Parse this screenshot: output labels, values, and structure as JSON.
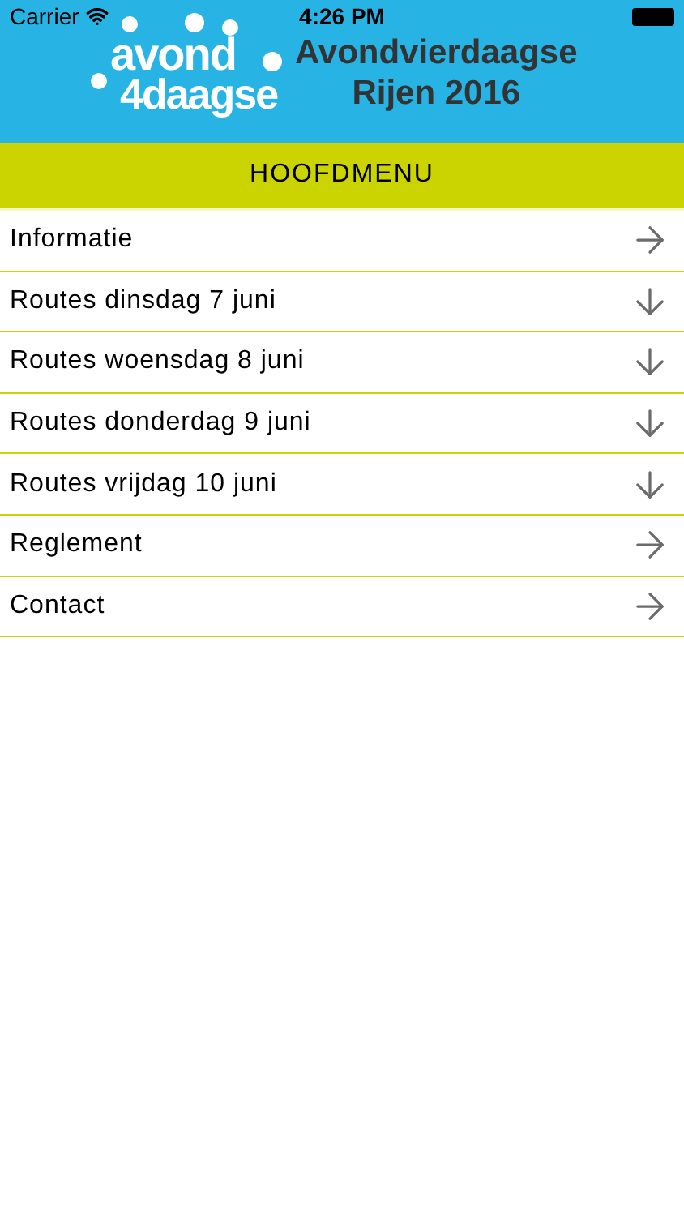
{
  "status_bar": {
    "carrier": "Carrier",
    "time": "4:26 PM"
  },
  "header": {
    "logo": [
      "avond",
      "4daagse"
    ],
    "title": [
      "Avondvierdaagse",
      "Rijen 2016"
    ]
  },
  "menu_title": "HOOFDMENU",
  "items": [
    {
      "label": "Informatie",
      "kind": "link"
    },
    {
      "label": "Routes dinsdag 7 juni",
      "kind": "expand"
    },
    {
      "label": "Routes woensdag 8 juni",
      "kind": "expand"
    },
    {
      "label": "Routes donderdag 9 juni",
      "kind": "expand"
    },
    {
      "label": "Routes vrijdag 10 juni",
      "kind": "expand"
    },
    {
      "label": "Reglement",
      "kind": "link"
    },
    {
      "label": "Contact",
      "kind": "link"
    }
  ]
}
